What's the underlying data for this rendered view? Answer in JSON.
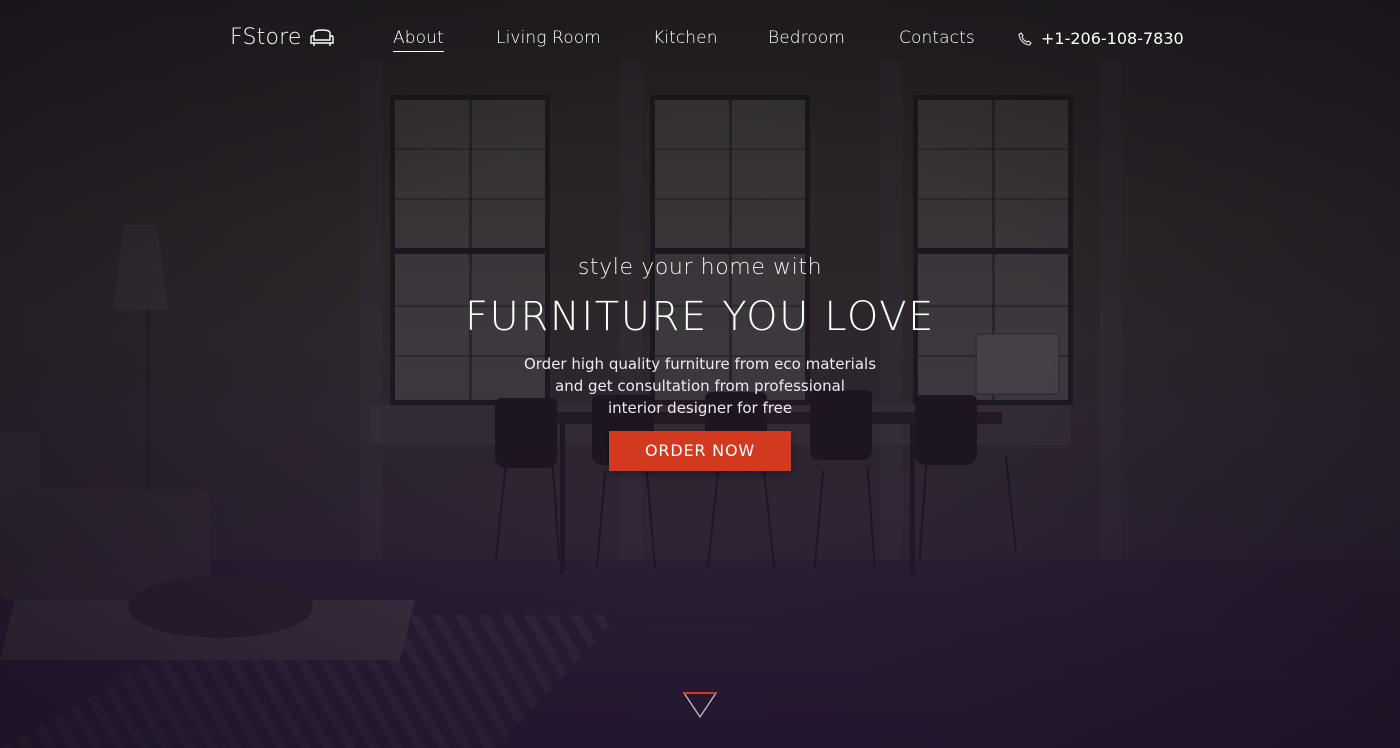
{
  "brand": {
    "name": "FStore",
    "icon": "armchair-icon"
  },
  "nav": {
    "items": [
      {
        "label": "About",
        "active": true
      },
      {
        "label": "Living Room",
        "active": false
      },
      {
        "label": "Kitchen",
        "active": false
      },
      {
        "label": "Bedroom",
        "active": false
      },
      {
        "label": "Contacts",
        "active": false
      }
    ],
    "phone": {
      "icon": "phone-icon",
      "number": "+1-206-108-7830"
    }
  },
  "hero": {
    "kicker": "style your home with",
    "title": "FURNITURE YOU LOVE",
    "description_lines": [
      "Order high quality furniture from eco materials",
      "and get consultation from professional",
      "interior designer for free"
    ],
    "cta_label": "ORDER NOW",
    "scroll_icon": "triangle-down-icon"
  },
  "colors": {
    "accent": "#d3391f",
    "text": "#ffffff",
    "overlay": "#2e1c3d"
  }
}
